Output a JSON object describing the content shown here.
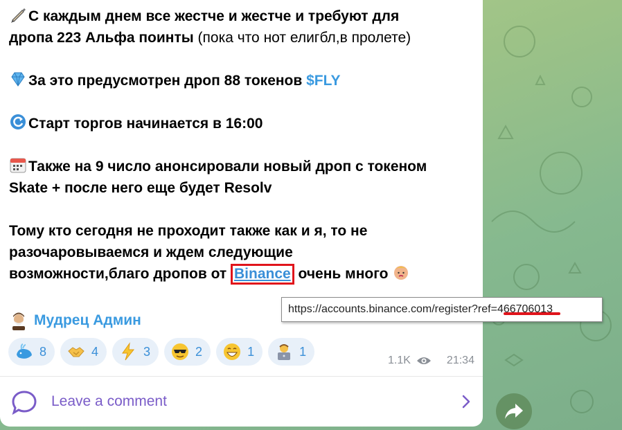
{
  "message": {
    "line1_pre": "С каждым днем все жестче и жестче и требуют для",
    "line2_bold": "дропа 223 Альфа поинты",
    "line2_rest": " (пока что нот елигбл,в пролете)",
    "para2_text": "За это предусмотрен дроп 88 токенов ",
    "para2_tag": "$FLY",
    "para3_text": "Старт торгов начинается в 16:00",
    "para4_line1": "Также на 9 число анонсировали новый дроп с токеном",
    "para4_line2": "Skate + после него еще будет Resolv",
    "para5_line1": "Тому кто сегодня не проходит также как и я, то не",
    "para5_line2": "разочаровываемся и ждем следующие",
    "para5_line3_pre": "возможности,благо дропов от ",
    "para5_link": "Binance",
    "para5_line3_post": " очень много"
  },
  "tooltip": {
    "url": "https://accounts.binance.com/register?ref=466706013"
  },
  "author": {
    "name": "Мудрец Админ"
  },
  "reactions": [
    {
      "icon": "whale-icon",
      "count": "8"
    },
    {
      "icon": "handshake-icon",
      "count": "4"
    },
    {
      "icon": "lightning-icon",
      "count": "3"
    },
    {
      "icon": "sunglasses-face-icon",
      "count": "2"
    },
    {
      "icon": "grinning-face-icon",
      "count": "1"
    },
    {
      "icon": "technologist-icon",
      "count": "1"
    }
  ],
  "meta": {
    "views": "1.1K",
    "time": "21:34"
  },
  "comments": {
    "label": "Leave a comment"
  },
  "colors": {
    "link": "#3a8fd8",
    "accent_purple": "#7a5cc8",
    "highlight_red": "#e0141b"
  }
}
